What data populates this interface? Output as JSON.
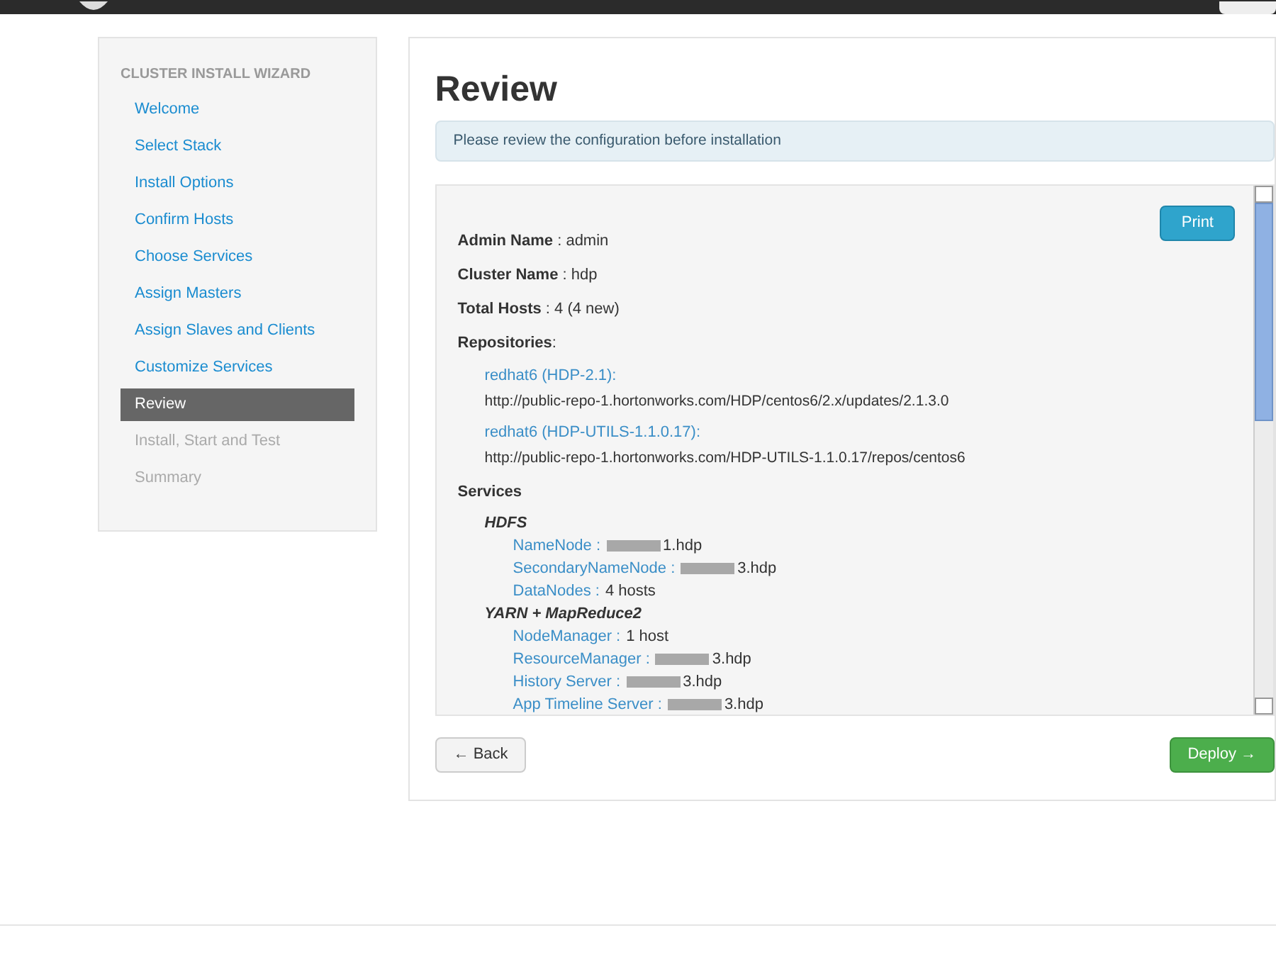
{
  "sidebar": {
    "title": "CLUSTER INSTALL WIZARD",
    "items": [
      {
        "label": "Welcome",
        "selected": false,
        "disabled": false
      },
      {
        "label": "Select Stack",
        "selected": false,
        "disabled": false
      },
      {
        "label": "Install Options",
        "selected": false,
        "disabled": false
      },
      {
        "label": "Confirm Hosts",
        "selected": false,
        "disabled": false
      },
      {
        "label": "Choose Services",
        "selected": false,
        "disabled": false
      },
      {
        "label": "Assign Masters",
        "selected": false,
        "disabled": false
      },
      {
        "label": "Assign Slaves and Clients",
        "selected": false,
        "disabled": false
      },
      {
        "label": "Customize Services",
        "selected": false,
        "disabled": false
      },
      {
        "label": "Review",
        "selected": true,
        "disabled": false
      },
      {
        "label": "Install, Start and Test",
        "selected": false,
        "disabled": true
      },
      {
        "label": "Summary",
        "selected": false,
        "disabled": true
      }
    ]
  },
  "title": "Review",
  "alert": "Please review the configuration before installation",
  "print_button": "Print",
  "fields": [
    "**Admin Name** : admin",
    "**Cluster Name** : hdp",
    "**Total Hosts** : 4 (4 new)"
  ],
  "repositories": {
    "label": "**Repositories**:",
    "items": [
      {
        "name": "redhat6 (HDP-2.1):",
        "url": "http://public-repo-1.hortonworks.com/HDP/centos6/2.x/updates/2.1.3.0"
      },
      {
        "name": "redhat6 (HDP-UTILS-1.1.0.17):",
        "url": "http://public-repo-1.hortonworks.com/HDP-UTILS-1.1.0.17/repos/centos6"
      }
    ]
  },
  "services": {
    "label": "Services",
    "groups": [
      {
        "name": "HDFS",
        "components": [
          {
            "label": "NameNode :",
            "value": "1.hdp",
            "redacted": true
          },
          {
            "label": "SecondaryNameNode :",
            "value": "3.hdp",
            "redacted": true
          },
          {
            "label": "DataNodes :",
            "value": "4 hosts",
            "redacted": false
          }
        ]
      },
      {
        "name": "YARN + MapReduce2",
        "components": [
          {
            "label": "NodeManager :",
            "value": "1 host",
            "redacted": false
          },
          {
            "label": "ResourceManager :",
            "value": "3.hdp",
            "redacted": true
          },
          {
            "label": "History Server :",
            "value": "3.hdp",
            "redacted": true
          },
          {
            "label": "App Timeline Server :",
            "value": "3.hdp",
            "redacted": true
          }
        ]
      }
    ]
  },
  "back_button": "← Back",
  "deploy_button": "Deploy →"
}
